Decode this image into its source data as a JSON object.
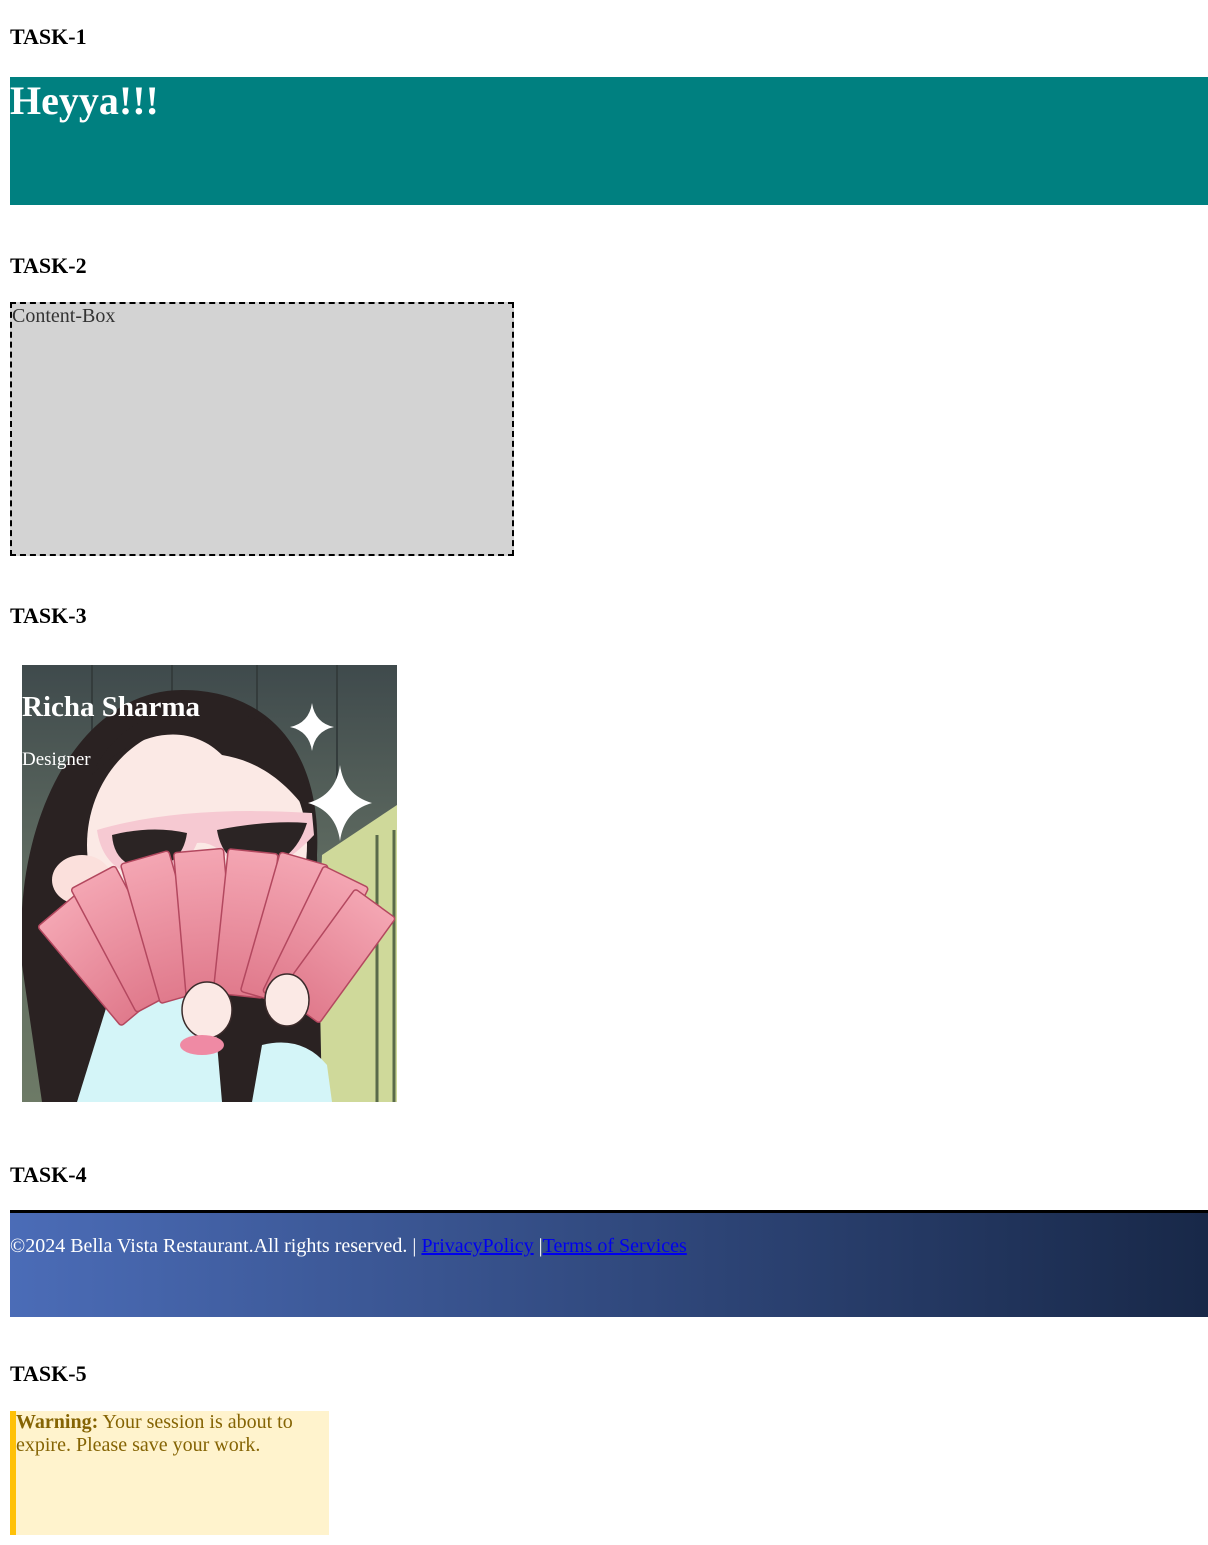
{
  "task1": {
    "heading": "TASK-1",
    "hero_title": "Heyya!!!",
    "bg_color": "#008080"
  },
  "task2": {
    "heading": "TASK-2",
    "box_text": "Content-Box",
    "bg_color": "#d3d3d3"
  },
  "task3": {
    "heading": "TASK-3",
    "name": "Richa Sharma",
    "role": "Designer",
    "image_description_icon": "anime-girl-holding-banknotes-image"
  },
  "task4": {
    "heading": "TASK-4",
    "copyright": "©2024 Bella Vista Restaurant.All rights reserved. | ",
    "privacy_link": "PrivacyPolicy",
    "separator": " |",
    "terms_link": "Terms of Services",
    "gradient_start": "#4b6cb7",
    "gradient_end": "#182848"
  },
  "task5": {
    "heading": "TASK-5",
    "warning_label": "Warning:",
    "warning_text": " Your session is about to expire. Please save your work.",
    "bg_color": "#fff3cd",
    "accent_color": "#ffc107"
  }
}
